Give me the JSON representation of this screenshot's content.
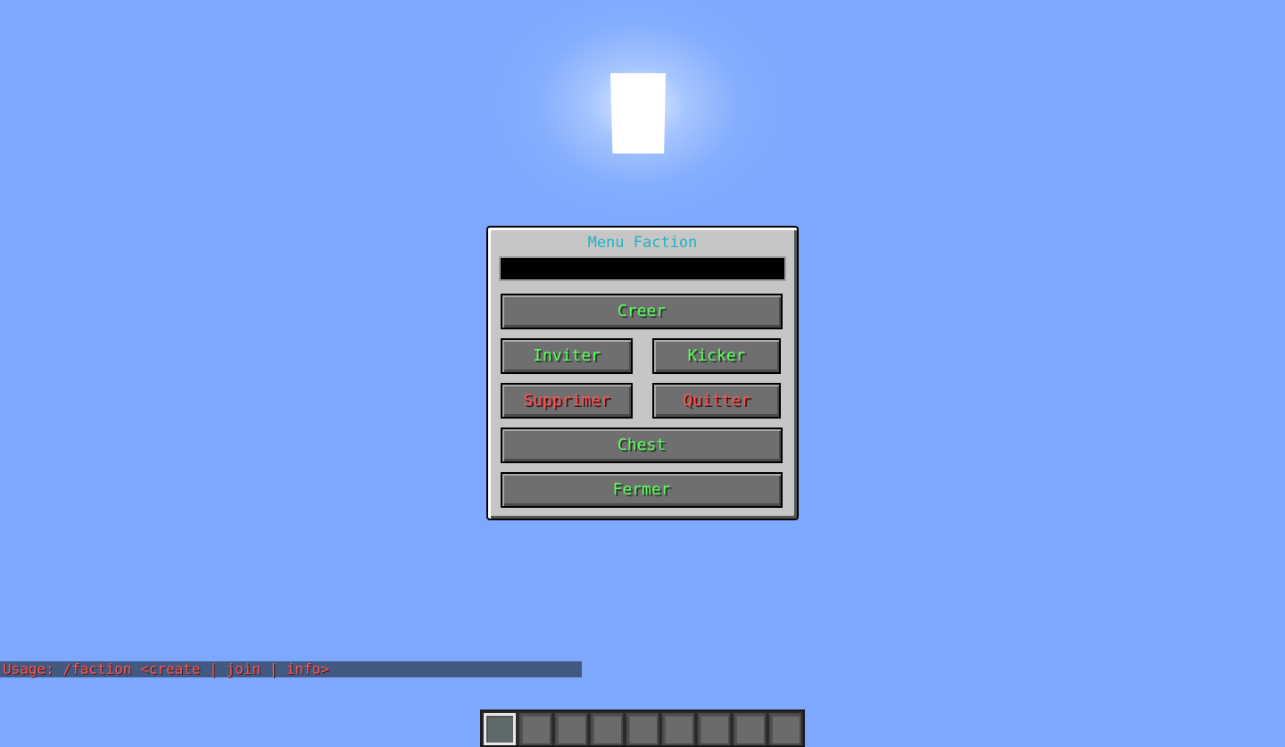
{
  "menu": {
    "title": "Menu Faction",
    "input_value": "",
    "buttons": {
      "create": "Creer",
      "invite": "Inviter",
      "kick": "Kicker",
      "delete": "Supprimer",
      "leave": "Quitter",
      "chest": "Chest",
      "close": "Fermer"
    }
  },
  "chat": {
    "message": "Usage: /faction <create | join | info>"
  },
  "hotbar": {
    "slot_count": 9,
    "selected_slot": 1
  },
  "colors": {
    "sky": "#7ea8fe",
    "title_color": "#1fb3c2",
    "positive_button_text": "#5dfc5d",
    "negative_button_text": "#fc5252",
    "chat_error_text": "#ff5555"
  }
}
